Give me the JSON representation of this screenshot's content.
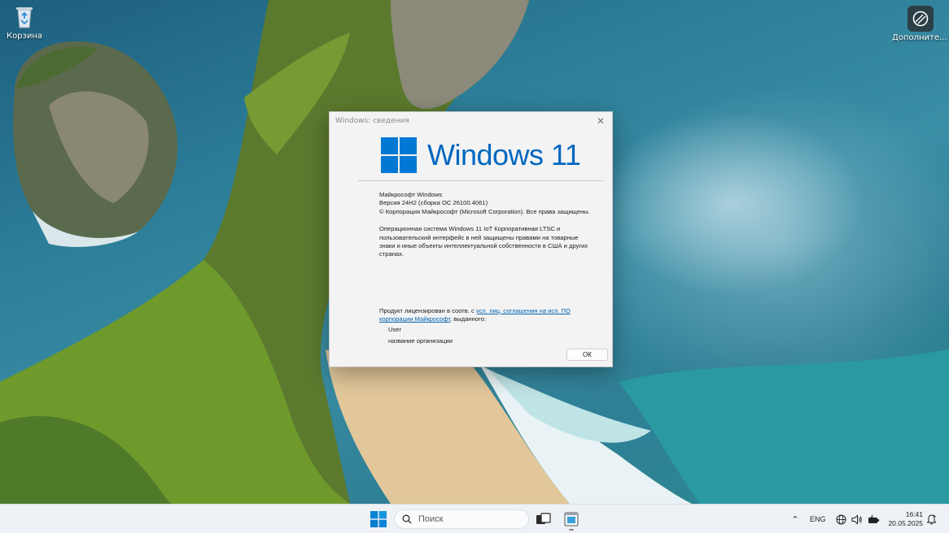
{
  "desktop": {
    "icons": [
      {
        "label": "Корзина",
        "icon": "recycle-bin-icon"
      },
      {
        "label": "Дополните... сведения о...",
        "icon": "extra-info-icon"
      }
    ]
  },
  "dialog": {
    "title": "Windows: сведения",
    "logo_text": "Windows 11",
    "info": {
      "line1": "Майкрософт Windows",
      "line2": "Версия 24H2 (сборка ОС 26100.4061)",
      "line3": "© Корпорация Майкрософт (Microsoft Corporation). Все права защищены.",
      "description": "Операционная система Windows 11 IoT Корпоративная LTSC и пользовательский интерфейс в ней защищены правами на товарные знаки и иные объекты интеллектуальной собственности в США и других странах."
    },
    "license": {
      "prefix": "Продукт лицензирован в соотв. с ",
      "link": "усл. лиц. соглашения на исп. ПО корпорации Майкрософт",
      "suffix": ", выданного:"
    },
    "user": "User",
    "organization": "название организации",
    "ok_label": "ОК"
  },
  "taskbar": {
    "search_placeholder": "Поиск",
    "language": "ENG",
    "time": "16:41",
    "date": "20.05.2025"
  },
  "colors": {
    "accent": "#0067c0",
    "link": "#0063b1",
    "taskbar": "#eef1f5"
  }
}
